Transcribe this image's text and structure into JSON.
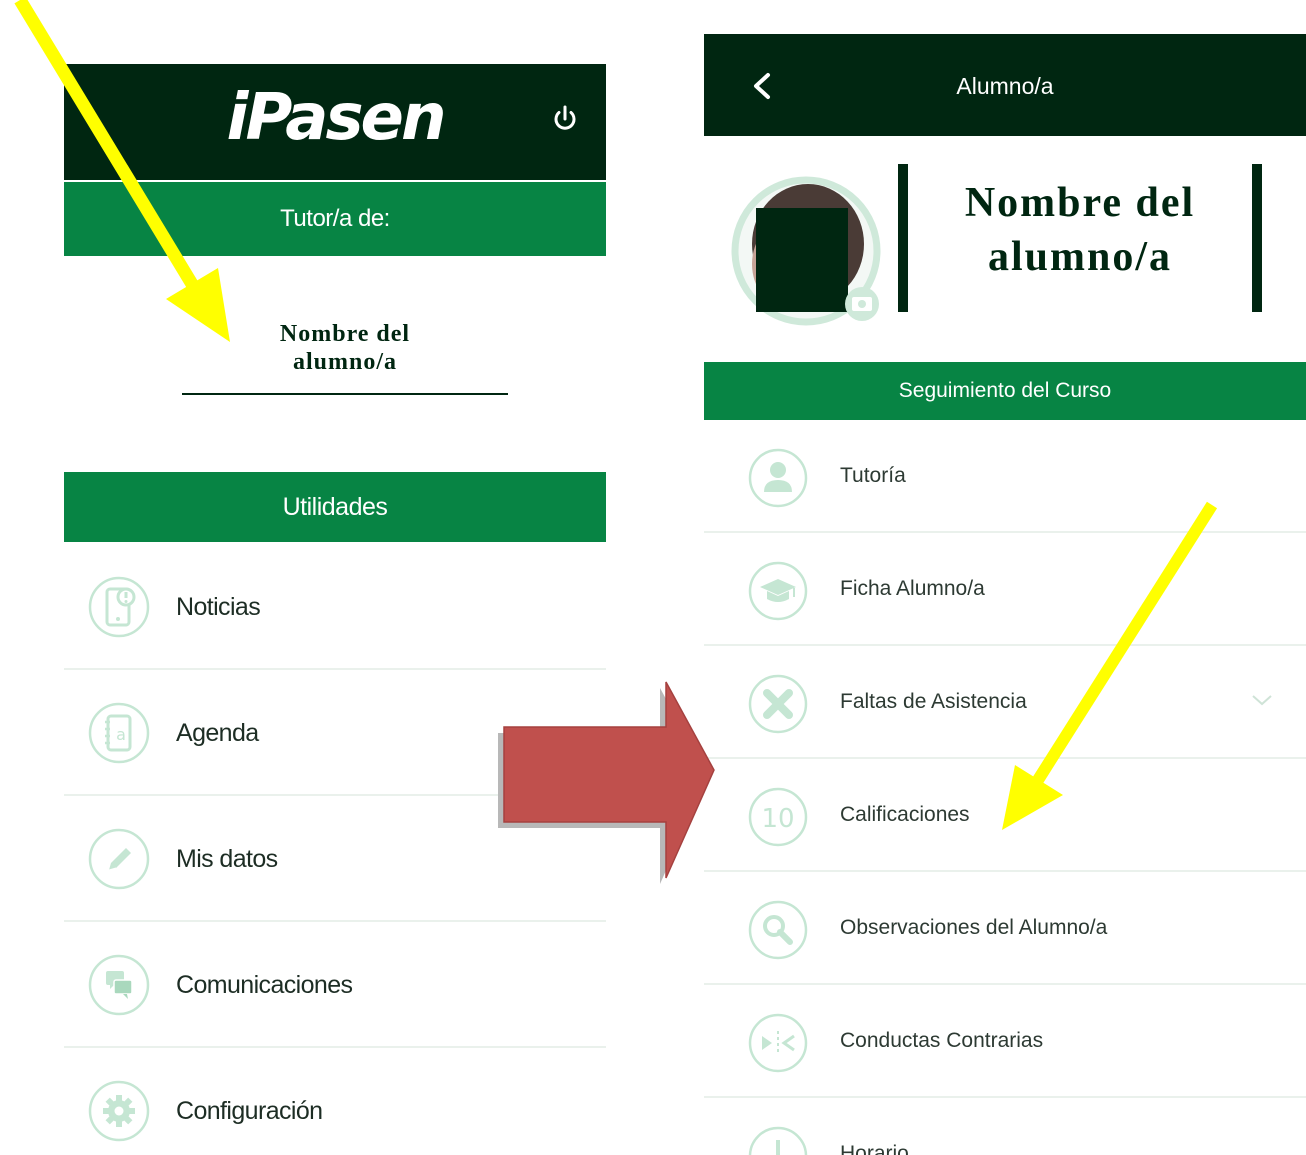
{
  "left_screen": {
    "app_title": "iPasen",
    "tutor_label": "Tutor/a de:",
    "student_name_line1": "Nombre del",
    "student_name_line2": "alumno/a",
    "section_title": "Utilidades",
    "items": [
      {
        "label": "Noticias",
        "icon": "news-phone-icon"
      },
      {
        "label": "Agenda",
        "icon": "agenda-book-icon"
      },
      {
        "label": "Mis datos",
        "icon": "pencil-icon"
      },
      {
        "label": "Comunicaciones",
        "icon": "chat-bubbles-icon"
      },
      {
        "label": "Configuración",
        "icon": "gear-icon"
      }
    ]
  },
  "right_screen": {
    "title": "Alumno/a",
    "student_name_line1": "Nombre del",
    "student_name_line2": "alumno/a",
    "section_title": "Seguimiento del Curso",
    "items": [
      {
        "label": "Tutoría",
        "icon": "person-icon"
      },
      {
        "label": "Ficha Alumno/a",
        "icon": "graduation-cap-icon"
      },
      {
        "label": "Faltas de Asistencia",
        "icon": "cross-icon"
      },
      {
        "label": "Calificaciones",
        "icon": "grade-ten-icon",
        "icon_text": "10"
      },
      {
        "label": "Observaciones del Alumno/a",
        "icon": "magnifier-icon"
      },
      {
        "label": "Conductas Contrarias",
        "icon": "conduct-icon"
      },
      {
        "label": "Horario",
        "icon": "clock-icon"
      }
    ]
  },
  "colors": {
    "header_dark": "#002611",
    "bar_green": "#078444",
    "icon_light": "#c5e6d3",
    "arrow_yellow": "#ffff00",
    "arrow_red": "#c0504d"
  }
}
